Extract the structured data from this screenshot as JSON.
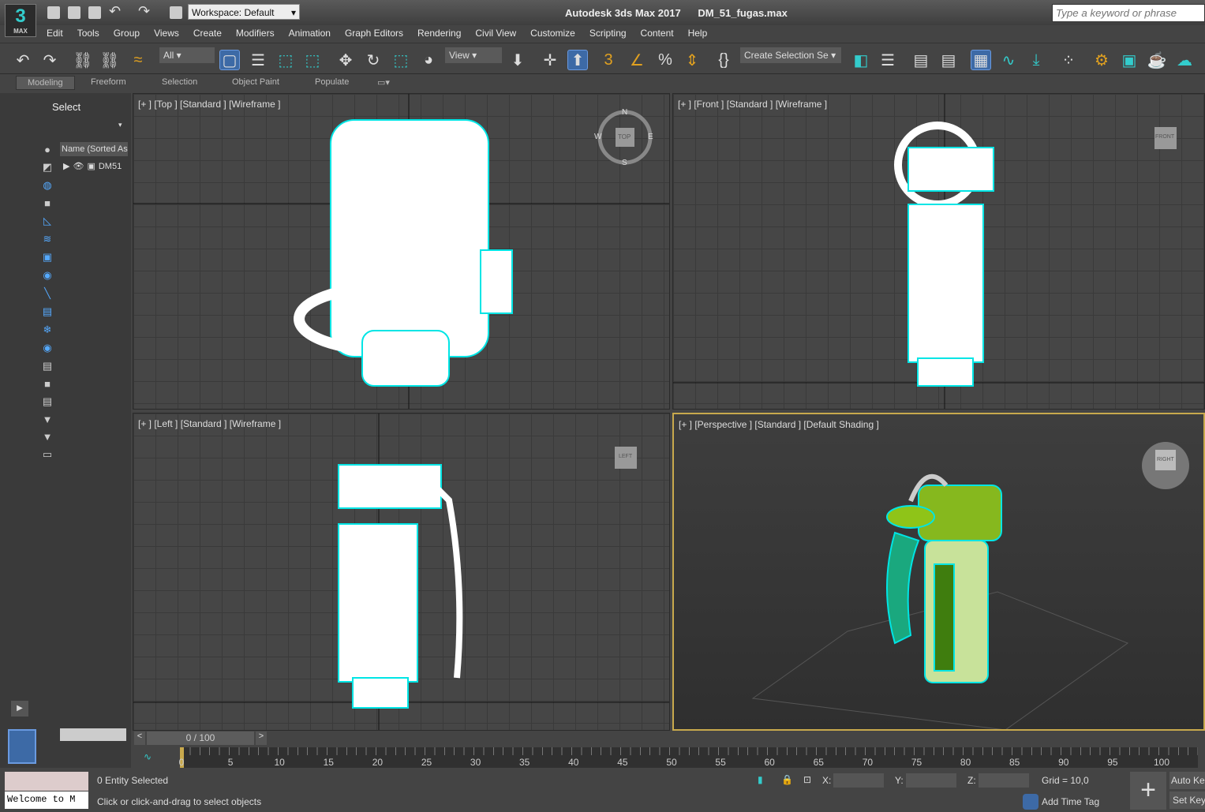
{
  "app": {
    "logo": "3",
    "logo_sub": "MAX",
    "title": "Autodesk 3ds Max 2017",
    "file": "DM_51_fugas.max",
    "workspace": "Workspace: Default",
    "search_placeholder": "Type a keyword or phrase"
  },
  "menu": [
    "Edit",
    "Tools",
    "Group",
    "Views",
    "Create",
    "Modifiers",
    "Animation",
    "Graph Editors",
    "Rendering",
    "Civil View",
    "Customize",
    "Scripting",
    "Content",
    "Help"
  ],
  "toolbar": {
    "filter": "All",
    "ref_coord": "View",
    "selection_set": "Create Selection Se"
  },
  "ribbon": {
    "tabs": [
      "Modeling",
      "Freeform",
      "Selection",
      "Object Paint",
      "Populate"
    ],
    "active": "Modeling"
  },
  "scene_explorer": {
    "mode": "Select",
    "column": "Name (Sorted Asc",
    "items": [
      "DM51"
    ]
  },
  "viewports": [
    {
      "label": "[+ ] [Top ] [Standard ] [Wireframe ]",
      "cube": "TOP",
      "compass": [
        "N",
        "E",
        "S",
        "W"
      ]
    },
    {
      "label": "[+ ] [Front ] [Standard ] [Wireframe ]",
      "cube": "FRONT"
    },
    {
      "label": "[+ ] [Left ] [Standard ] [Wireframe ]",
      "cube": "LEFT"
    },
    {
      "label": "[+ ] [Perspective ] [Standard ] [Default Shading ]",
      "cube": "RIGHT"
    }
  ],
  "timeline": {
    "frame": "0 / 100",
    "ticks": [
      "0",
      "5",
      "10",
      "15",
      "20",
      "25",
      "30",
      "35",
      "40",
      "45",
      "50",
      "55",
      "60",
      "65",
      "70",
      "75",
      "80",
      "85",
      "90",
      "95",
      "100"
    ]
  },
  "status": {
    "maxscript": "Welcome to M",
    "selected": "0 Entity Selected",
    "prompt": "Click or click-and-drag to select objects",
    "x_label": "X:",
    "y_label": "Y:",
    "z_label": "Z:",
    "x": "",
    "y": "",
    "z": "",
    "grid": "Grid = 10,0",
    "add_time_tag": "Add Time Tag",
    "auto_key": "Auto Ke",
    "set_key": "Set Key"
  },
  "colors": {
    "accent": "#3d6aa6",
    "selection": "#00e5e5",
    "active_border": "#c8a94d",
    "object_green": "#86b81e"
  }
}
